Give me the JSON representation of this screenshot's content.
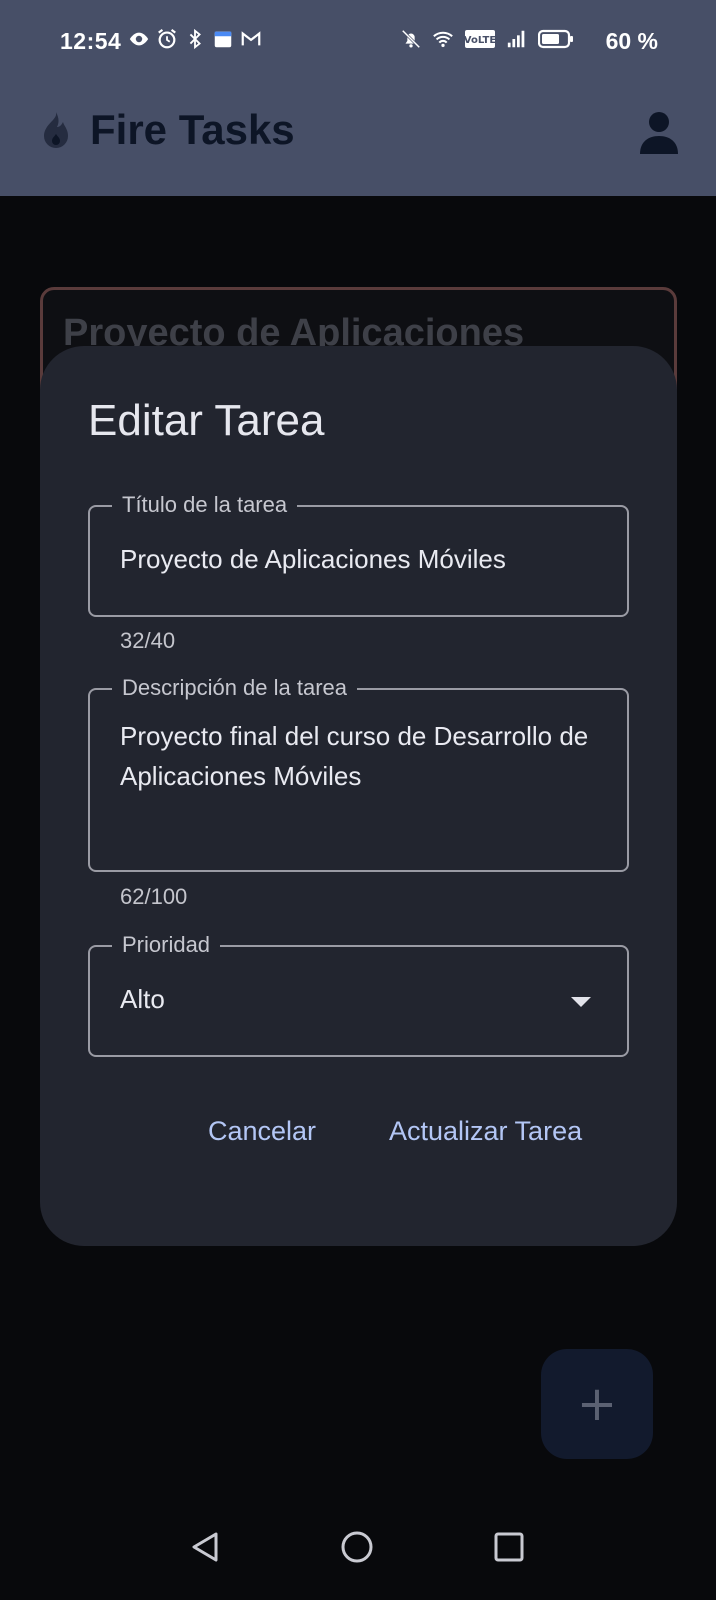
{
  "status_bar": {
    "time": "12:54",
    "battery_percent": "60 %",
    "icons_left": [
      "eye-icon",
      "alarm-icon",
      "bluetooth-icon",
      "calendar-icon",
      "gmail-icon"
    ],
    "icons_right": [
      "bell-off-icon",
      "wifi-icon",
      "volte-icon",
      "signal-icon",
      "battery-icon"
    ]
  },
  "app_bar": {
    "title": "Fire Tasks",
    "icon": "flame-icon",
    "profile_icon": "person-icon"
  },
  "background": {
    "task_card_title": "Proyecto de Aplicaciones"
  },
  "dialog": {
    "title": "Editar Tarea",
    "title_field": {
      "label": "Título de la tarea",
      "value": "Proyecto de Aplicaciones Móviles",
      "counter": "32/40"
    },
    "description_field": {
      "label": "Descripción de la tarea",
      "value": "Proyecto final del curso de Desarrollo de Aplicaciones Móviles",
      "counter": "62/100"
    },
    "priority_field": {
      "label": "Prioridad",
      "value": "Alto"
    },
    "cancel_label": "Cancelar",
    "update_label": "Actualizar Tarea"
  },
  "fab": {
    "icon": "plus-icon",
    "symbol": "+"
  },
  "colors": {
    "app_bar": "#474f67",
    "dialog_bg": "#22252f",
    "accent_text": "#b3c6f5",
    "scrim_bg": "#08090c"
  }
}
